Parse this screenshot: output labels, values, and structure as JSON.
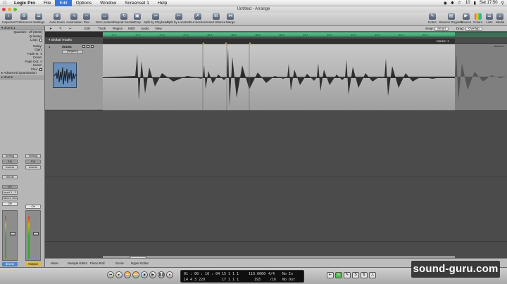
{
  "menubar": {
    "items": [
      "Logic Pro",
      "File",
      "Edit",
      "Options",
      "Window",
      "Screenset 1",
      "Help"
    ],
    "active_index": 2,
    "status_battery": "10",
    "clock": "Sat 17:50"
  },
  "window": {
    "title": "Untitled - Arrange"
  },
  "toolbar": {
    "left": [
      "Inspector",
      "Preferences",
      "Settings"
    ],
    "middle": [
      "Auto Zoom",
      "Automation",
      "Flex",
      "Set Locators",
      "Repeat Section",
      "Crop",
      "Split by Playhead",
      "Split by Locators",
      "Cut Section",
      "Insert Silence",
      "Merge"
    ],
    "right": [
      "Notes",
      "Bounce Regions",
      "Bounce",
      "Colors",
      "Lists",
      "Media"
    ]
  },
  "localmenu": {
    "items": [
      "Edit",
      "Track",
      "Region",
      "MIDI",
      "Audio",
      "View"
    ],
    "snap_label": "Snap:",
    "snap_value": "Smart",
    "drag_label": "Drag:",
    "drag_value": "Overlap"
  },
  "inspector": {
    "region_header": "drums.1",
    "params": [
      {
        "label": "Quantize:",
        "value": "off (3840)"
      },
      {
        "label": "Q-Swing:",
        "value": ""
      },
      {
        "label": "Loop:",
        "value": "",
        "check": true
      },
      {
        "label": "Delay:",
        "value": ""
      },
      {
        "label": "Gain:",
        "value": ""
      },
      {
        "label": "Fade In:",
        "value": "0"
      },
      {
        "label": "Curve:",
        "value": ""
      },
      {
        "label": "Fade Out:",
        "value": "0"
      },
      {
        "label": "Curve:",
        "value": ""
      },
      {
        "label": "Flex:",
        "value": "",
        "check": true
      }
    ],
    "advanced": "Advanced Quantization",
    "track_header": "drums",
    "strip1": {
      "setting": "Setting",
      "eq": "EQ",
      "inserts": "Inserts",
      "sends": "Sends",
      "io": "I/O",
      "input": "Input 1 - 2",
      "output": "Stereo Out",
      "mode": "Off",
      "name": "drums"
    },
    "strip2": {
      "setting": "Setting",
      "eq": "EQ",
      "inserts": "Inserts",
      "mode": "Off",
      "name": "Output"
    }
  },
  "global_tracks": {
    "label": "Global Tracks",
    "marker": "Marker 1"
  },
  "ruler": {
    "ticks": [
      "17.1",
      "17.2",
      "17.3",
      "17.4",
      "18.1",
      "18.2",
      "18.3",
      "18.4",
      "19.1",
      "19.2",
      "19.3",
      "19.4",
      "20.1",
      "20.2"
    ]
  },
  "track": {
    "number": "1",
    "name": "drums",
    "instrument": "(Rhythm)",
    "region_name": "drums.1"
  },
  "bottom_tabs": [
    "Mixer",
    "Sample Editor",
    "Piano Roll",
    "Score",
    "Hyper Editor"
  ],
  "transport": {
    "smpte": "01 : 00 : 10 : 04",
    "bars": "14   4   3   229",
    "locator1": "15   1   1   1",
    "locator2": "17   1   1   1",
    "tempo": "119.0000",
    "divisions": "193",
    "signature": "4/4",
    "division": "/16",
    "in_label": "No In",
    "out_label": "No Out"
  },
  "watermark": "sound-guru.com"
}
